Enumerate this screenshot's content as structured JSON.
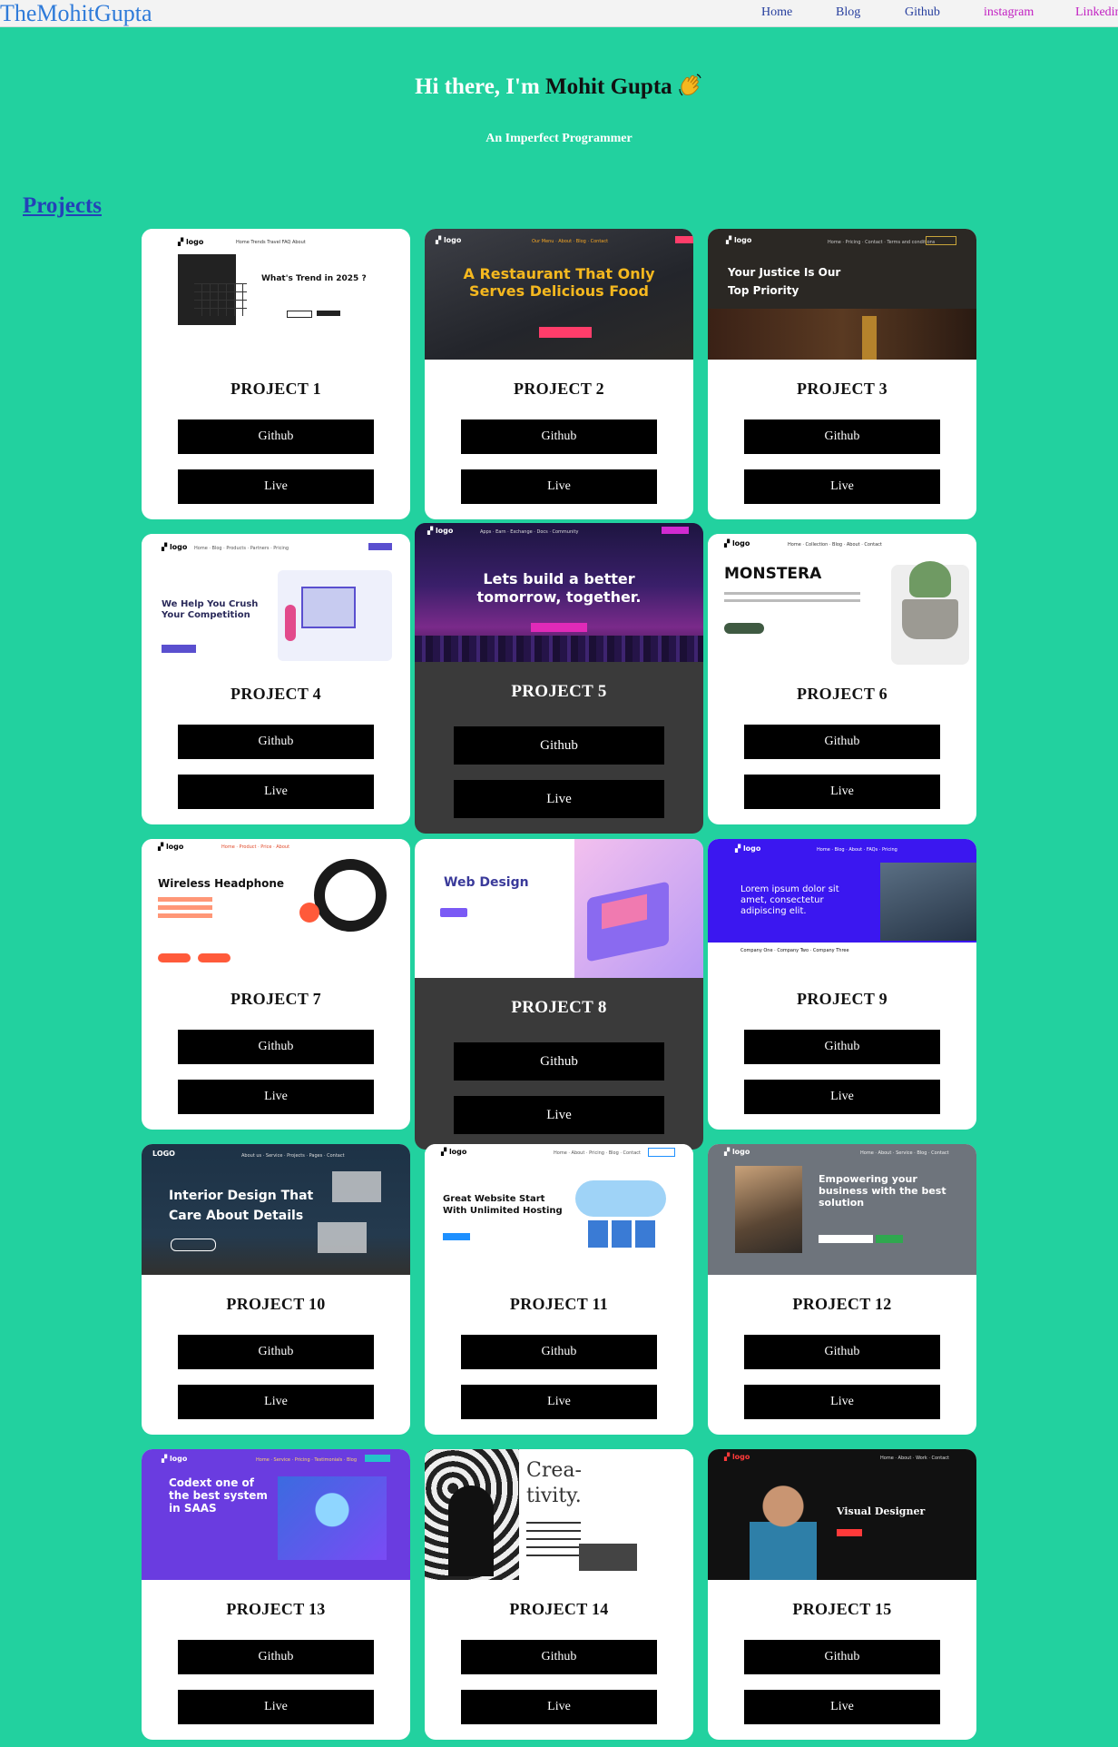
{
  "nav": {
    "brand": "TheMohitGupta",
    "links": [
      "Home",
      "Blog",
      "Github",
      "instagram",
      "Linkedin"
    ]
  },
  "hero": {
    "greeting": "Hi there, I'm",
    "name": "Mohit Gupta",
    "subtitle": "An Imperfect Programmer"
  },
  "section_title": "Projects",
  "buttons": {
    "github": "Github",
    "live": "Live"
  },
  "projects": [
    {
      "title": "PROJECT 1",
      "thumb_text": "What's Trend in 2025 ?"
    },
    {
      "title": "PROJECT 2",
      "thumb_text": "A Restaurant That Only Serves Delicious Food"
    },
    {
      "title": "PROJECT 3",
      "thumb_text": "Your Justice Is Our Top Priority"
    },
    {
      "title": "PROJECT 4",
      "thumb_text": "We Help You Crush Your Competition"
    },
    {
      "title": "PROJECT 5",
      "thumb_text": "Lets build a better tomorrow, together."
    },
    {
      "title": "PROJECT 6",
      "thumb_text": "MONSTERA"
    },
    {
      "title": "PROJECT 7",
      "thumb_text": "Wireless Headphone"
    },
    {
      "title": "PROJECT 8",
      "thumb_text": "Web Design"
    },
    {
      "title": "PROJECT 9",
      "thumb_text": "Lorem ipsum dolor sit amet, consectetur adipiscing elit."
    },
    {
      "title": "PROJECT 10",
      "thumb_text": "Interior Design That Care About Details"
    },
    {
      "title": "PROJECT 11",
      "thumb_text": "Great Website Start With Unlimited Hosting"
    },
    {
      "title": "PROJECT 12",
      "thumb_text": "Empowering your business with the best solution"
    },
    {
      "title": "PROJECT 13",
      "thumb_text": "Codext one of the best system in SAAS"
    },
    {
      "title": "PROJECT 14",
      "thumb_text": "Crea- tivity."
    },
    {
      "title": "PROJECT 15",
      "thumb_text": "Visual Designer"
    }
  ],
  "colors": {
    "background": "#22d19f",
    "nav_background": "#f3f3f3",
    "brand": "#2f7bd9",
    "button": "#000000",
    "dark_card": "#3a3a3a"
  },
  "icons": {
    "wave": "waving-hand-icon"
  }
}
